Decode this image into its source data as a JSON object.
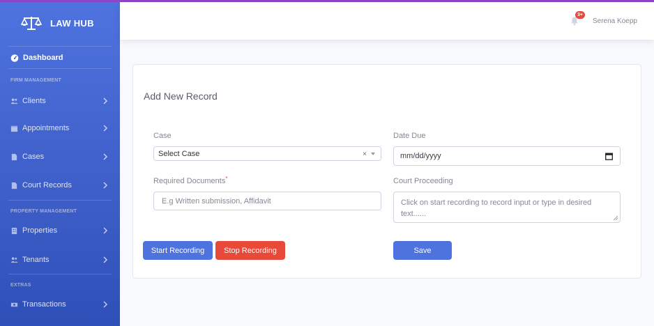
{
  "brand": {
    "name": "LAW HUB"
  },
  "sidebar": {
    "dashboard": "Dashboard",
    "headings": {
      "firm": "FIRM MANAGEMENT",
      "property": "PROPERTY MANAGEMENT",
      "extras": "EXTRAS"
    },
    "items": [
      {
        "label": "Clients",
        "icon": "users-icon"
      },
      {
        "label": "Appointments",
        "icon": "calendar-icon"
      },
      {
        "label": "Cases",
        "icon": "file-icon"
      },
      {
        "label": "Court Records",
        "icon": "file-icon"
      },
      {
        "label": "Properties",
        "icon": "building-icon"
      },
      {
        "label": "Tenants",
        "icon": "users-icon"
      },
      {
        "label": "Transactions",
        "icon": "money-icon"
      }
    ]
  },
  "topbar": {
    "badge": "3+",
    "user": "Serena Koepp"
  },
  "form": {
    "title": "Add New Record",
    "case_label": "Case",
    "case_value": "Select Case",
    "case_clear": "×",
    "date_label": "Date Due",
    "date_value": "mm/dd/yyyy",
    "docs_label": "Required Documents",
    "docs_required_mark": "*",
    "docs_placeholder": "E.g Written submission, Affidavit",
    "court_label": "Court Proceeding",
    "court_placeholder": "Click on start recording to record input or type in desired text......",
    "start_recording": "Start Recording",
    "stop_recording": "Stop Recording",
    "save": "Save"
  },
  "colors": {
    "primary": "#4e73df",
    "danger": "#e74a3b",
    "accent_top": "#8e44c9"
  }
}
